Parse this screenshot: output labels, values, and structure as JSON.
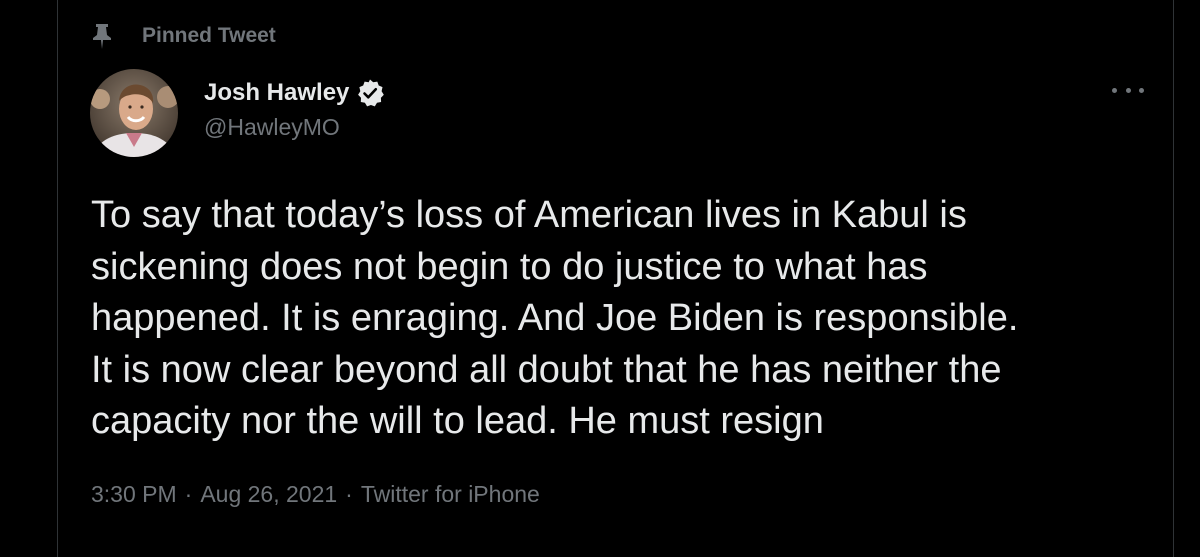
{
  "pinned": {
    "label": "Pinned Tweet",
    "icon": "pin-icon"
  },
  "author": {
    "display_name": "Josh Hawley",
    "handle": "@HawleyMO",
    "verified": true,
    "verified_icon": "verified-badge-icon",
    "avatar_icon": "avatar-photo"
  },
  "more_icon": "more-options-icon",
  "tweet": {
    "text": "To say that today’s loss of American lives in Kabul is\nsickening does not begin to do justice to what has\nhappened. It is enraging. And Joe Biden is responsible.\nIt is now clear beyond all doubt that he has neither the\ncapacity nor the will to lead. He must resign"
  },
  "meta": {
    "time": "3:30 PM",
    "separator": "·",
    "date": "Aug 26, 2021",
    "source": "Twitter for iPhone"
  },
  "colors": {
    "background": "#000000",
    "text_primary": "#e7e9ea",
    "text_secondary": "#71767b",
    "divider": "#2f3336",
    "verified_badge": "#e7e9ea"
  }
}
